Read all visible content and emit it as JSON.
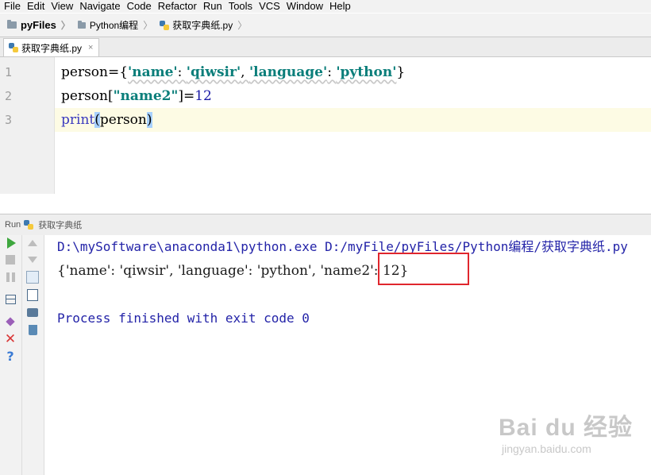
{
  "menu": [
    "File",
    "Edit",
    "View",
    "Navigate",
    "Code",
    "Refactor",
    "Run",
    "Tools",
    "VCS",
    "Window",
    "Help"
  ],
  "breadcrumb": [
    "pyFiles",
    "Python编程",
    "获取字典纸.py"
  ],
  "tab": {
    "label": "获取字典纸.py",
    "close": "×"
  },
  "editor": {
    "line_numbers": [
      "1",
      "2",
      "3"
    ],
    "line1": {
      "a": "person={",
      "s1": "'name'",
      "c1": ": ",
      "s2": "'qiwsir'",
      "c2": ", ",
      "s3": "'language'",
      "c3": ": ",
      "s4": "'python'",
      "z": "}"
    },
    "line2": {
      "a": "person[",
      "s": "\"name2\"",
      "b": "]=",
      "n": "12"
    },
    "line3": {
      "a": "print",
      "p1": "(",
      "b": "person",
      "p2": ")"
    }
  },
  "run_panel": {
    "label": "Run",
    "config": "获取字典纸"
  },
  "console": {
    "command": "D:\\mySoftware\\anaconda1\\python.exe D:/myFile/pyFiles/Python编程/获取字典纸.py",
    "output": "{'name': 'qiwsir', 'language': 'python', 'name2': 12}",
    "finish": "Process finished with exit code 0"
  },
  "colors": {
    "highlight_box": "#e0262d",
    "console_text": "#2323a8",
    "string": "#0a7e7a"
  },
  "watermark": {
    "main": "Bai du 经验",
    "sub": "jingyan.baidu.com"
  }
}
